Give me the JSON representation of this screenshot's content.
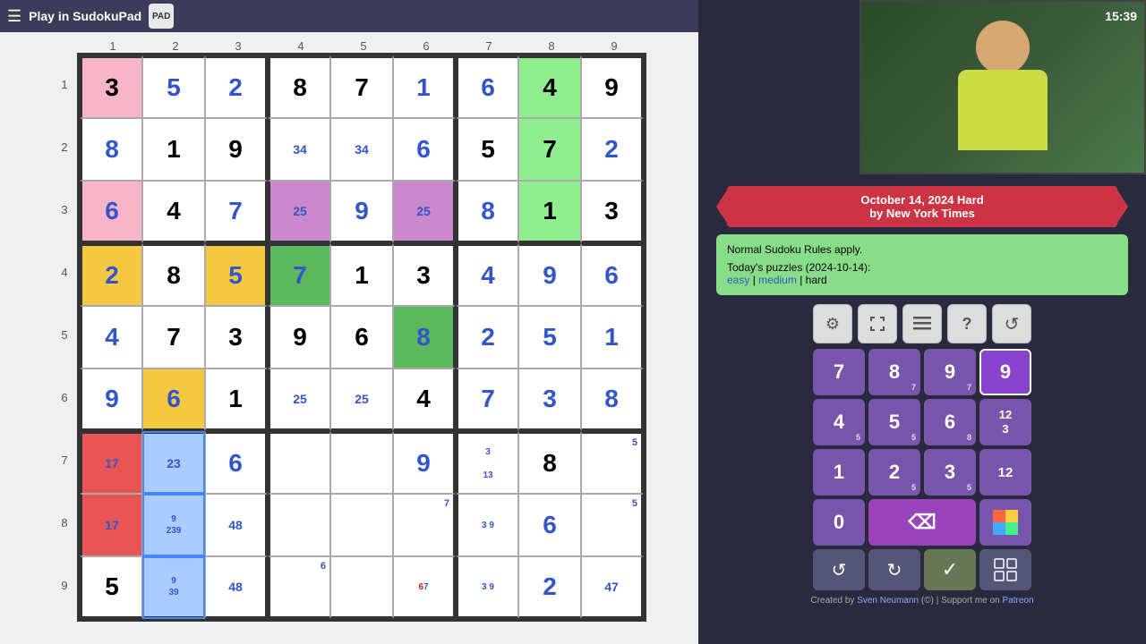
{
  "topbar": {
    "title": "Play in SudokuPad",
    "logo_text": "PAD",
    "menu_icon": "☰"
  },
  "timer": "15:39",
  "ribbon": {
    "line1": "October 14, 2024 Hard",
    "line2": "by New York Times"
  },
  "info": {
    "rules": "Normal Sudoku Rules apply.",
    "puzzles_label": "Today's puzzles (2024-10-14):",
    "easy": "easy",
    "medium": "medium",
    "hard": "hard",
    "sep1": " | ",
    "sep2": " | "
  },
  "toolbar": {
    "settings": "⚙",
    "fullscreen": "⛶",
    "list": "≡",
    "help": "?",
    "undo_icon": "↺"
  },
  "numpad": {
    "row1": [
      {
        "val": "7",
        "sub": ""
      },
      {
        "val": "8",
        "sub": "7"
      },
      {
        "val": "9",
        "sub": "7"
      },
      {
        "val": "9",
        "sub": "",
        "active": true
      }
    ],
    "row2": [
      {
        "val": "4",
        "sub": "5"
      },
      {
        "val": "5",
        "sub": "5"
      },
      {
        "val": "6",
        "sub": "8"
      },
      {
        "val": "12\n3",
        "sub": "",
        "mode": true
      }
    ],
    "row3": [
      {
        "val": "1",
        "sub": ""
      },
      {
        "val": "2",
        "sub": "5"
      },
      {
        "val": "3",
        "sub": "5"
      },
      {
        "val": "12",
        "sub": "",
        "mode": true
      }
    ],
    "row4_special": [
      {
        "val": "0",
        "type": "zero"
      },
      {
        "val": "⌫",
        "type": "delete"
      },
      {
        "val": "◈",
        "type": "color"
      }
    ]
  },
  "bottom_actions": {
    "undo": "↺",
    "redo": "↻",
    "check": "✓",
    "grid": "⊞"
  },
  "credit": {
    "text": "Created by",
    "author": "Sven Neumann",
    "support": "Support me on",
    "platform": "Patreon"
  },
  "col_headers": [
    "1",
    "2",
    "3",
    "4",
    "5",
    "6",
    "7",
    "8",
    "9"
  ],
  "row_headers": [
    "1",
    "2",
    "3",
    "4",
    "5",
    "6",
    "7",
    "8",
    "9"
  ],
  "grid": [
    [
      {
        "v": "3",
        "type": "given",
        "bg": "pink"
      },
      {
        "v": "5",
        "type": "blue"
      },
      {
        "v": "2",
        "type": "blue"
      },
      {
        "v": "8",
        "type": "given"
      },
      {
        "v": "7",
        "type": "given"
      },
      {
        "v": "1",
        "type": "blue"
      },
      {
        "v": "6",
        "type": "blue"
      },
      {
        "v": "4",
        "type": "given",
        "bg": "green"
      },
      {
        "v": "9",
        "type": "given"
      }
    ],
    [
      {
        "v": "8",
        "type": "blue"
      },
      {
        "v": "1",
        "type": "given"
      },
      {
        "v": "9",
        "type": "given"
      },
      {
        "v": "34",
        "type": "candidate"
      },
      {
        "v": "34",
        "type": "candidate"
      },
      {
        "v": "6",
        "type": "blue"
      },
      {
        "v": "5",
        "type": "given"
      },
      {
        "v": "7",
        "type": "given",
        "bg": "green"
      },
      {
        "v": "2",
        "type": "blue"
      }
    ],
    [
      {
        "v": "6",
        "type": "blue",
        "bg": "pink"
      },
      {
        "v": "4",
        "type": "given"
      },
      {
        "v": "7",
        "type": "blue"
      },
      {
        "v": "25",
        "type": "candidate",
        "bg": "purple"
      },
      {
        "v": "9",
        "type": "blue"
      },
      {
        "v": "25",
        "type": "candidate",
        "bg": "purple"
      },
      {
        "v": "8",
        "type": "blue"
      },
      {
        "v": "1",
        "type": "given",
        "bg": "green"
      },
      {
        "v": "3",
        "type": "given"
      }
    ],
    [
      {
        "v": "2",
        "type": "blue",
        "bg": "orange"
      },
      {
        "v": "8",
        "type": "given"
      },
      {
        "v": "5",
        "type": "blue",
        "bg": "orange"
      },
      {
        "v": "7",
        "type": "blue",
        "bg": "teal"
      },
      {
        "v": "1",
        "type": "given"
      },
      {
        "v": "3",
        "type": "given"
      },
      {
        "v": "4",
        "type": "blue"
      },
      {
        "v": "9",
        "type": "blue"
      },
      {
        "v": "6",
        "type": "blue"
      }
    ],
    [
      {
        "v": "4",
        "type": "blue"
      },
      {
        "v": "7",
        "type": "given"
      },
      {
        "v": "3",
        "type": "given"
      },
      {
        "v": "9",
        "type": "given"
      },
      {
        "v": "6",
        "type": "given"
      },
      {
        "v": "8",
        "type": "blue",
        "bg": "teal"
      },
      {
        "v": "2",
        "type": "blue"
      },
      {
        "v": "5",
        "type": "blue"
      },
      {
        "v": "1",
        "type": "blue"
      }
    ],
    [
      {
        "v": "9",
        "type": "blue"
      },
      {
        "v": "6",
        "type": "blue",
        "bg": "orange"
      },
      {
        "v": "1",
        "type": "given"
      },
      {
        "v": "25",
        "type": "candidate"
      },
      {
        "v": "25",
        "type": "candidate"
      },
      {
        "v": "4",
        "type": "given"
      },
      {
        "v": "7",
        "type": "blue"
      },
      {
        "v": "3",
        "type": "blue"
      },
      {
        "v": "8",
        "type": "blue"
      }
    ],
    [
      {
        "v": "17",
        "type": "candidate",
        "bg": "red"
      },
      {
        "v": "23",
        "type": "candidate",
        "bg": "blue-sel"
      },
      {
        "v": "6",
        "type": "blue"
      },
      {
        "v": "",
        "type": "empty"
      },
      {
        "v": "",
        "type": "empty"
      },
      {
        "v": "9",
        "type": "blue"
      },
      {
        "v": "3\n13",
        "type": "candidate2"
      },
      {
        "v": "8",
        "type": "given"
      },
      {
        "v": "5",
        "type": "candidate-small"
      }
    ],
    [
      {
        "v": "17",
        "type": "candidate",
        "bg": "red"
      },
      {
        "v": "9\n239",
        "type": "candidate-multi",
        "bg": "blue-sel"
      },
      {
        "v": "48",
        "type": "candidate"
      },
      {
        "v": "",
        "type": "empty"
      },
      {
        "v": "",
        "type": "empty"
      },
      {
        "v": "7",
        "type": "candidate-small"
      },
      {
        "v": "3  9",
        "type": "candidate2"
      },
      {
        "v": "6",
        "type": "blue"
      },
      {
        "v": "5",
        "type": "candidate-small"
      }
    ],
    [
      {
        "v": "5",
        "type": "given"
      },
      {
        "v": "9\n39",
        "type": "candidate-multi",
        "bg": "blue-sel"
      },
      {
        "v": "48",
        "type": "candidate"
      },
      {
        "v": "6",
        "type": "candidate-small"
      },
      {
        "v": "",
        "type": "empty"
      },
      {
        "v": "6  7",
        "type": "candidate2-red"
      },
      {
        "v": "3  9",
        "type": "candidate2"
      },
      {
        "v": "2",
        "type": "blue"
      },
      {
        "v": "47",
        "type": "candidate"
      }
    ]
  ]
}
